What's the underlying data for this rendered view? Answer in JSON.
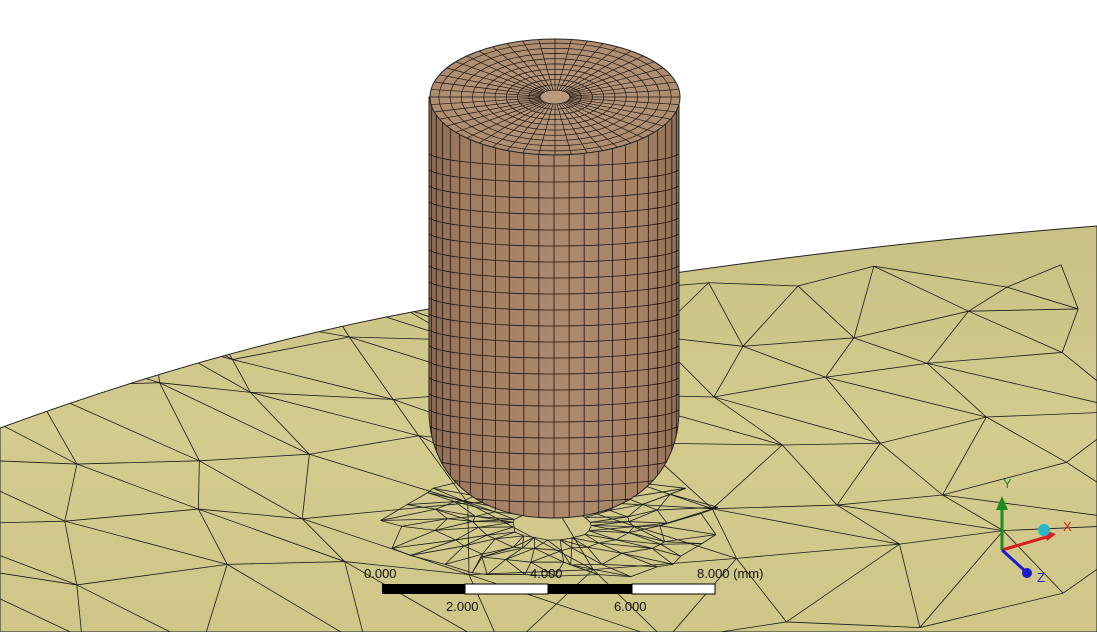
{
  "viewport": {
    "background": "#ffffff",
    "surface_color": "#cfc68a",
    "part_color": "#a88266",
    "mesh_line_color": "#111111"
  },
  "scale_bar": {
    "top_labels": [
      "0.000",
      "4.000",
      "8.000 (mm)"
    ],
    "bottom_labels": [
      "2.000",
      "6.000"
    ]
  },
  "triad": {
    "x_label": "X",
    "y_label": "Y",
    "z_label": "Z",
    "x_color": "#d62020",
    "y_color": "#1e8c1e",
    "z_color": "#1a1ad0",
    "origin_color": "#2ab5c8"
  }
}
